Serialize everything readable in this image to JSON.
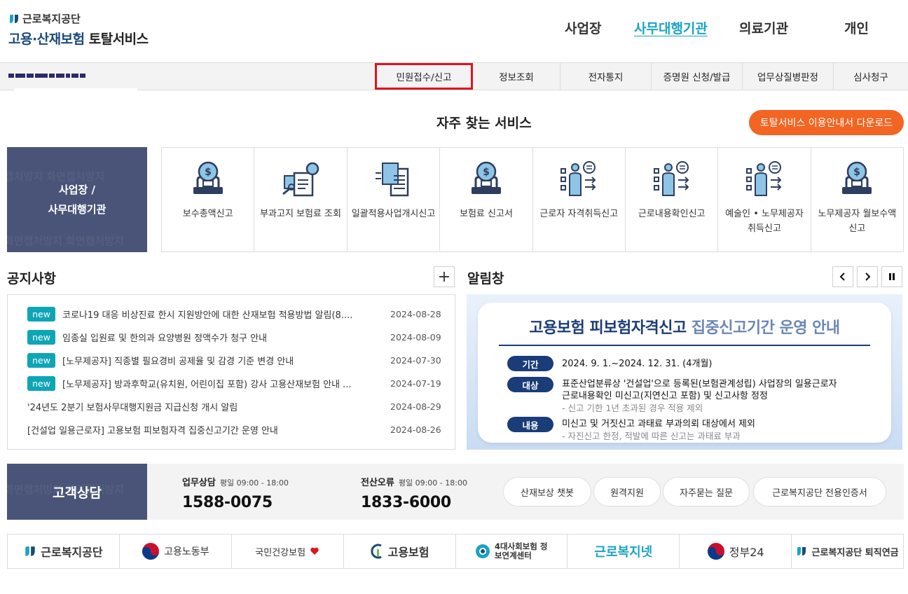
{
  "brand": {
    "org": "근로복지공단",
    "service_prefix": "고용·산재보험",
    "service_suffix": "토탈서비스"
  },
  "topnav": [
    {
      "label": "사업장",
      "active": false
    },
    {
      "label": "사무대행기관",
      "active": true
    },
    {
      "label": "의료기관",
      "active": false
    },
    {
      "label": "개인",
      "active": false
    }
  ],
  "subnav": [
    {
      "label": "민원접수/신고",
      "highlighted": true
    },
    {
      "label": "정보조회"
    },
    {
      "label": "전자통지"
    },
    {
      "label": "증명원 신청/발급"
    },
    {
      "label": "업무상질병판정"
    },
    {
      "label": "심사청구"
    }
  ],
  "frequent": {
    "title": "자주 찾는 서비스",
    "download_label": "토탈서비스 이용안내서 다운로드",
    "side_line1": "사업장 /",
    "side_line2": "사무대행기관",
    "items": [
      {
        "label": "보수총액신고",
        "icon": "money-bulb-icon"
      },
      {
        "label": "부과고지 보험료 조회",
        "icon": "document-search-icon"
      },
      {
        "label": "일괄적용사업개시신고",
        "icon": "document-stack-icon"
      },
      {
        "label": "보험료 신고서",
        "icon": "money-bulb-icon"
      },
      {
        "label": "근로자 자격취득신고",
        "icon": "person-chart-icon"
      },
      {
        "label": "근로내용확인신고",
        "icon": "person-chart-icon"
      },
      {
        "label": "예술인 • 노무제공자 취득신고",
        "icon": "person-chart-icon"
      },
      {
        "label": "노무제공자 월보수액 신고",
        "icon": "money-bulb-icon"
      }
    ]
  },
  "notice": {
    "title": "공지사항",
    "more_label": "+",
    "badge": "new",
    "items": [
      {
        "text": "코로나19 대응 비상진료 한시 지원방안에 대한 산재보험 적용방법 알림(8....",
        "date": "2024-08-28",
        "is_new": true
      },
      {
        "text": "임종실 입원료 및 한의과 요양병원 정액수가 청구 안내",
        "date": "2024-08-09",
        "is_new": true
      },
      {
        "text": "[노무제공자] 직종별 필요경비 공제율 및 감경 기준 변경 안내",
        "date": "2024-07-30",
        "is_new": true
      },
      {
        "text": "[노무제공자] 방과후학교(유치원, 어린이집 포함) 강사 고용산재보험 안내 ...",
        "date": "2024-07-19",
        "is_new": true
      },
      {
        "text": "'24년도 2분기 보험사무대행지원금 지급신청 개시 알림",
        "date": "2024-08-29",
        "is_new": false
      },
      {
        "text": "[건설업 일용근로자] 고용보험 피보험자격 집중신고기간 운영 안내",
        "date": "2024-08-26",
        "is_new": false
      }
    ]
  },
  "alarm": {
    "title": "알림창",
    "banner_title_main": "고용보험 피보험자격신고",
    "banner_title_sub": "집중신고기간 운영 안내",
    "rows": [
      {
        "pill": "기간",
        "lines": [
          "2024. 9. 1.~2024. 12. 31. (4개월)"
        ],
        "sub": ""
      },
      {
        "pill": "대상",
        "lines": [
          "표준산업분류상 '건설업'으로 등록된(보험관계성립) 사업장의 일용근로자",
          "근로내용확인 미신고(지연신고 포함) 및 신고사항 정정"
        ],
        "sub": "- 신고 기한 1년 초과된 경우 적용 제외"
      },
      {
        "pill": "내용",
        "lines": [
          "미신고 및 거짓신고 과태료 부과의뢰 대상에서 제외"
        ],
        "sub": "- 자진신고 한정, 적발에 따른 신고는 과태료 부과"
      }
    ]
  },
  "counsel": {
    "title": "고객상담",
    "items": [
      {
        "label": "업무상담",
        "hours": "평일 09:00 - 18:00",
        "phone": "1588-0075"
      },
      {
        "label": "전산오류",
        "hours": "평일 09:00 - 18:00",
        "phone": "1833-6000"
      }
    ],
    "buttons": [
      "산재보상 챗봇",
      "원격지원",
      "자주묻는 질문",
      "근로복지공단 전용인증서"
    ]
  },
  "partners": [
    {
      "name": "근로복지공단"
    },
    {
      "name": "고용노동부"
    },
    {
      "name": "국민건강보험"
    },
    {
      "name": "고용보험"
    },
    {
      "name": "4대사회보험 정보연계센터"
    },
    {
      "name": "근로복지넷"
    },
    {
      "name": "정부24"
    },
    {
      "name": "근로복지공단 퇴직연금"
    }
  ],
  "colors": {
    "accent_teal": "#1aa3c4",
    "orange": "#f26522",
    "navy_panel": "#4a5478",
    "highlight_red": "#e0141e",
    "badge_teal": "#0ea5b6"
  }
}
